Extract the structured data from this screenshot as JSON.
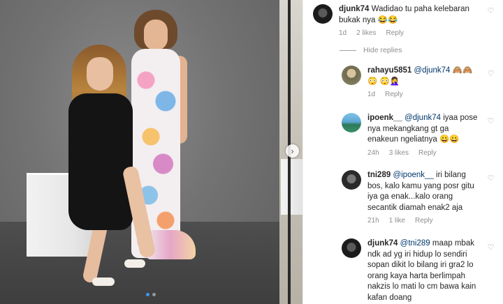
{
  "photo": {
    "carousel_next_glyph": "›",
    "dots_total": 2,
    "dots_active": 0
  },
  "comments": {
    "top": {
      "username": "djunk74",
      "text": "Wadidao tu paha kelebaran bukak nya 😂😂",
      "time": "1d",
      "likes": "2 likes",
      "reply": "Reply"
    },
    "hide_replies": "Hide replies",
    "replies": [
      {
        "username": "rahayu5851",
        "mention": "@djunk74",
        "text": " 🙈🙈😳 😳🤦‍♀️",
        "time": "1d",
        "likes": "",
        "reply": "Reply"
      },
      {
        "username": "ipoenk__",
        "mention": "@djunk74",
        "text": " iyaa pose nya mekangkang gt ga enakeun ngeliatnya 😀😀",
        "time": "24h",
        "likes": "3 likes",
        "reply": "Reply"
      },
      {
        "username": "tni289",
        "mention": "@ipoenk__",
        "text": " iri bilang bos, kalo kamu yang posr gitu iya ga enak...kalo orang secantik diamah enak2 aja",
        "time": "21h",
        "likes": "1 like",
        "reply": "Reply"
      },
      {
        "username": "djunk74",
        "mention": "@tni289",
        "text": " maap mbak ndk ad yg iri hidup lo sendiri sopan dikit lo bilang iri gra2 lo orang kaya harta berlimpah nakzis lo mati lo cm bawa kain kafan doang",
        "time": "",
        "likes": "",
        "reply": ""
      }
    ],
    "like_icon_glyph": "♡"
  },
  "colors": {
    "username": "#262626",
    "mention": "#00376b",
    "meta": "#8e8e8e",
    "active_dot": "#3897f0"
  }
}
